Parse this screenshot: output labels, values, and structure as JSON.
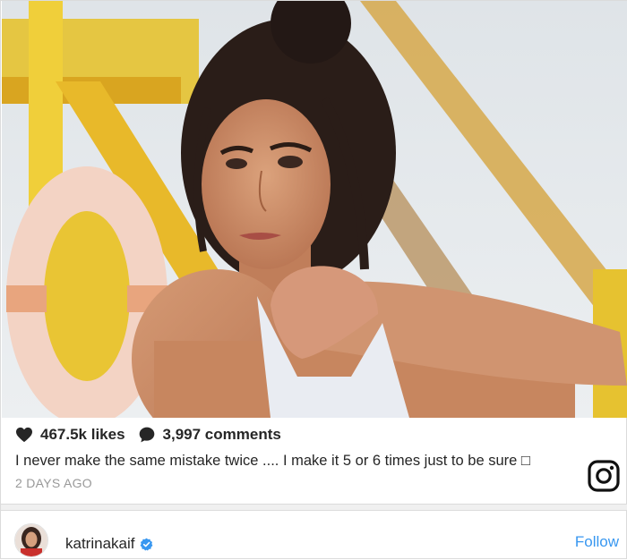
{
  "post": {
    "likes": "467.5k likes",
    "comments": "3,997 comments",
    "caption": "I never make the same mistake twice .... I make it 5 or 6 times just to be sure □",
    "timestamp": "2 DAYS AGO"
  },
  "account": {
    "username": "katrinakaif",
    "follow_label": "Follow"
  },
  "icons": {
    "like": "heart-icon",
    "comment": "comment-bubble-icon",
    "brand": "instagram-logo-icon",
    "verified": "verified-badge-icon"
  },
  "colors": {
    "text": "#262626",
    "muted": "#999999",
    "link": "#3897f0",
    "verified": "#3897f0"
  }
}
